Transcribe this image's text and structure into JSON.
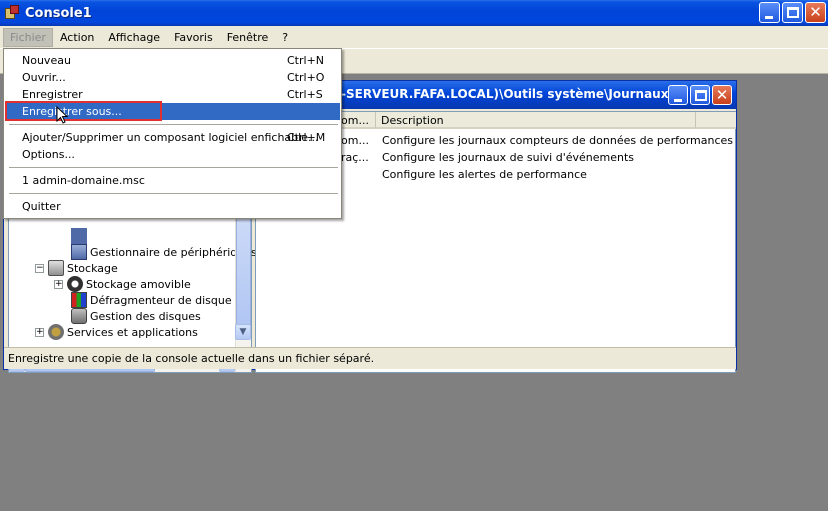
{
  "window": {
    "title": "Console1"
  },
  "menubar": [
    "Fichier",
    "Action",
    "Affichage",
    "Favoris",
    "Fenêtre",
    "?"
  ],
  "file_menu": [
    {
      "label": "Nouveau",
      "shortcut": "Ctrl+N"
    },
    {
      "label": "Ouvrir...",
      "shortcut": "Ctrl+O"
    },
    {
      "label": "Enregistrer",
      "shortcut": "Ctrl+S"
    },
    {
      "label": "Enregistrer sous...",
      "shortcut": "",
      "highlighted": true
    },
    {
      "label": "Ajouter/Supprimer un composant logiciel enfichable...",
      "shortcut": "Ctrl+M"
    },
    {
      "label": "Options...",
      "shortcut": ""
    },
    {
      "label": "1 admin-domaine.msc",
      "shortcut": ""
    },
    {
      "label": "Quitter",
      "shortcut": ""
    }
  ],
  "child_window": {
    "title": "-SERVEUR.FAFA.LOCAL)\\Outils système\\Journaux..."
  },
  "tree": {
    "items": [
      {
        "label": "Gestionnaire de périphériques",
        "icon": "device-manager-icon"
      },
      {
        "label": "Stockage",
        "icon": "storage-icon"
      },
      {
        "label": "Stockage amovible",
        "icon": "removable-storage-icon"
      },
      {
        "label": "Défragmenteur de disque",
        "icon": "defrag-icon"
      },
      {
        "label": "Gestion des disques",
        "icon": "disk-management-icon"
      },
      {
        "label": "Services et applications",
        "icon": "services-icon"
      }
    ]
  },
  "list": {
    "columns": [
      "om...",
      "Description"
    ],
    "rows": [
      {
        "name": "om...",
        "description": "Configure les journaux compteurs de données de performances"
      },
      {
        "name": "raç...",
        "description": "Configure les journaux de suivi d'événements"
      },
      {
        "name": "",
        "description": "Configure les alertes de performance"
      }
    ]
  },
  "statusbar": {
    "text": "Enregistre une copie de la console actuelle dans un fichier séparé."
  },
  "colors": {
    "titlebar": "#0044d8",
    "selection": "#316ac5",
    "annotation": "#e03030",
    "workspace": "#808080"
  }
}
